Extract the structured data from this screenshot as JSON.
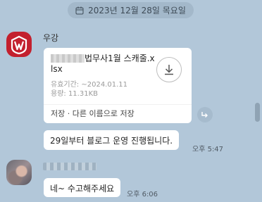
{
  "date_divider": {
    "label": "2023년 12월 28일 목요일",
    "icon": "calendar-icon"
  },
  "colors": {
    "background": "#b2c7d9",
    "logo": "#c3202e",
    "bubble": "#ffffff"
  },
  "messages": {
    "first": {
      "sender": "우강",
      "avatar": "logo-avatar",
      "file": {
        "name_visible": "법무사1월 스캐줄.xlsx",
        "validity_label": "유효기간: ~2024.01.11",
        "size_label": "용량: 11.31KB",
        "save_label": "저장",
        "separator": "·",
        "save_as_label": "다른 이름으로 저장",
        "download_icon": "download-icon"
      },
      "share_icon": "share-icon",
      "text": "29일부터 블로그 운영 진행됩니다.",
      "time": "오후 5:47"
    },
    "second": {
      "avatar": "person-avatar",
      "text": "네~ 수고해주세요",
      "time": "오후 6:06"
    }
  }
}
